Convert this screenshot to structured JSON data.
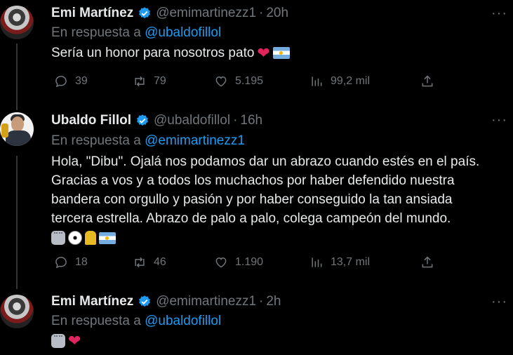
{
  "tweets": [
    {
      "name": "Emi Martínez",
      "handle": "@emimartinezz1",
      "dot": "·",
      "time": "20h",
      "reply_prefix": "En respuesta a",
      "reply_mention": "@ubaldofillol",
      "text": "Sería un honor para nosotros pato",
      "emojis": [
        "red-heart",
        "argentina-flag"
      ],
      "replies": "39",
      "retweets": "79",
      "likes": "5.195",
      "views": "99,2 mil"
    },
    {
      "name": "Ubaldo Fillol",
      "handle": "@ubaldofillol",
      "dot": "·",
      "time": "16h",
      "reply_prefix": "En respuesta a",
      "reply_mention": "@emimartinezz1",
      "text_lines": [
        "Hola, \"Dibu\". Ojalá nos podamos dar un abrazo cuando estés en el país.",
        "Gracias a vos y a todos los muchachos por haber defendido nuestra",
        "bandera con orgullo y pasión y por haber conseguido la tan ansiada",
        "tercera estrella. Abrazo de palo a palo, colega campeón del mundo."
      ],
      "emojis": [
        "goalkeeper-glove",
        "soccer-ball",
        "trophy",
        "argentina-flag"
      ],
      "replies": "18",
      "retweets": "46",
      "likes": "1.190",
      "views": "13,7 mil"
    },
    {
      "name": "Emi Martínez",
      "handle": "@emimartinezz1",
      "dot": "·",
      "time": "2h",
      "reply_prefix": "En respuesta a",
      "reply_mention": "@ubaldofillol",
      "emojis": [
        "goalkeeper-glove",
        "red-heart"
      ]
    }
  ],
  "more_label": "···",
  "colors": {
    "background": "#000000",
    "text": "#e7e9ea",
    "muted": "#71767b",
    "link": "#1d9bf0",
    "verified": "#1d9bf0"
  }
}
